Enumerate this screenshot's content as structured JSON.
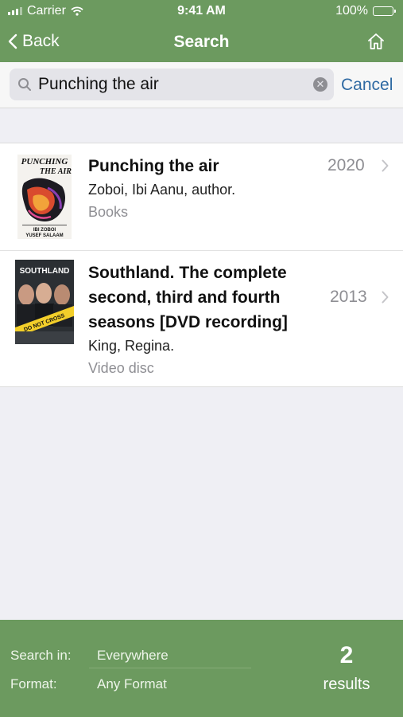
{
  "status_bar": {
    "carrier": "Carrier",
    "time": "9:41 AM",
    "battery": "100%"
  },
  "nav": {
    "back_label": "Back",
    "title": "Search"
  },
  "search": {
    "query": "Punching the air",
    "cancel_label": "Cancel"
  },
  "results": [
    {
      "title": "Punching the air",
      "author": "Zoboi, Ibi Aanu, author.",
      "format": "Books",
      "year": "2020",
      "cover_lines": [
        "PUNCHING",
        "THE AIR",
        "IBI ZOBOI",
        "YUSEF SALAAM"
      ]
    },
    {
      "title": "Southland. The complete second, third and fourth seasons [DVD recording]",
      "title_lines": [
        "Southland. The complete",
        "second, third and fourth",
        "seasons [DVD recording]"
      ],
      "author": "King, Regina.",
      "format": "Video disc",
      "year": "2013",
      "cover_lines": [
        "SOUTHLAND",
        "DO NOT CROSS"
      ]
    }
  ],
  "footer": {
    "search_in_label": "Search in:",
    "search_in_value": "Everywhere",
    "format_label": "Format:",
    "format_value": "Any Format",
    "count": "2",
    "count_label": "results"
  },
  "colors": {
    "brand_green": "#6c9a5f",
    "link_blue": "#2f6aa3",
    "secondary_gray": "#8e8e93"
  },
  "icons": {
    "back": "chevron-left-icon",
    "home": "home-icon",
    "search": "magnifier-icon",
    "clear": "clear-circle-icon",
    "disclosure": "chevron-right-icon"
  }
}
